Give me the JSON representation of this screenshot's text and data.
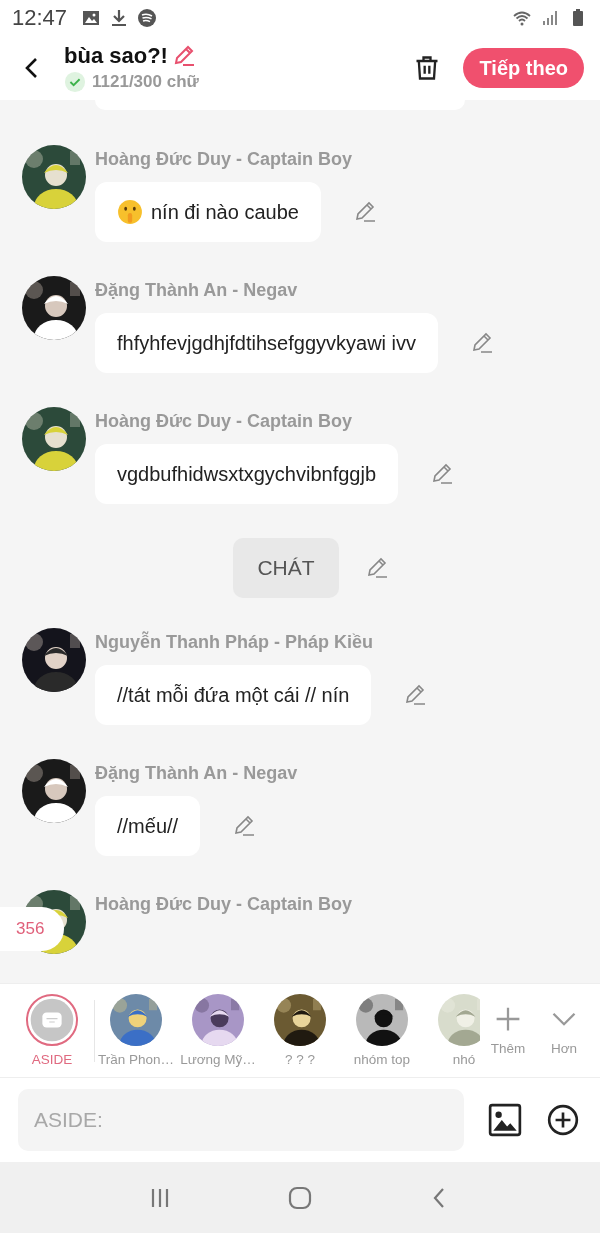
{
  "status_bar": {
    "time": "12:47"
  },
  "header": {
    "title": "bùa sao?!",
    "word_count": "1121/300 chữ",
    "word_count_ok": true,
    "next_button": "Tiếp theo"
  },
  "messages": [
    {
      "kind": "message",
      "author": "Hoàng Đức Duy - Captain Boy",
      "emoji": true,
      "text": "nín đi nào caube"
    },
    {
      "kind": "message",
      "author": "Đặng Thành An - Negav",
      "text": "fhfyhfevjgdhjfdtihsefggyvkyawi ivv"
    },
    {
      "kind": "message",
      "author": "Hoàng Đức Duy - Captain Boy",
      "text": "vgdbufhidwsxtxgychvibnfggjb"
    },
    {
      "kind": "narration",
      "text": "CHÁT"
    },
    {
      "kind": "message",
      "author": "Nguyễn Thanh Pháp - Pháp Kiều",
      "text": "//tát mỗi đứa một cái // nín"
    },
    {
      "kind": "message",
      "author": "Đặng Thành An - Negav",
      "text": "//mếu//"
    },
    {
      "kind": "message",
      "author": "Hoàng Đức Duy - Captain Boy"
    }
  ],
  "count_badge": "356",
  "characters": [
    {
      "kind": "aside",
      "label": "ASIDE",
      "selected": true
    },
    {
      "kind": "avatar",
      "label": "Trần Phon…",
      "selected": false
    },
    {
      "kind": "avatar",
      "label": "Lương Mỹ…",
      "selected": false
    },
    {
      "kind": "avatar",
      "label": "? ? ?",
      "selected": false
    },
    {
      "kind": "avatar",
      "label": "nhóm top",
      "selected": false
    },
    {
      "kind": "avatar",
      "label": "nhó",
      "selected": false
    }
  ],
  "actions": [
    {
      "kind": "add",
      "label": "Thêm"
    },
    {
      "kind": "more",
      "label": "Hơn"
    }
  ],
  "input": {
    "placeholder": "ASIDE:"
  }
}
